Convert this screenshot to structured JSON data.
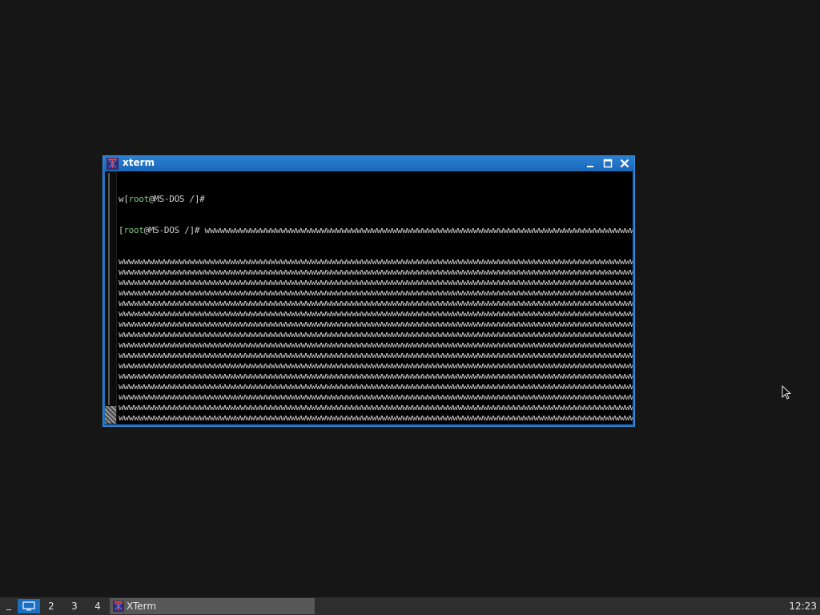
{
  "window": {
    "title": "xterm",
    "terminal": {
      "line1": {
        "prefix": "w[",
        "user": "root",
        "host": "@MS-DOS /]#",
        "rest": ""
      },
      "line2": {
        "prefix": "[",
        "user": "root",
        "host": "@MS-DOS /]#",
        "rest": " wwwwwwwwwwwwwwwwwwwwwwwwwwwwwwwwwwwwwwwwwwwwwwwwwwwwwwwwwwwwwwwwwwwwwwwwwwwwwwwwwwwwwwwwwwwwwwwwwww"
      },
      "fill_line": "wwwwwwwwwwwwwwwwwwwwwwwwwwwwwwwwwwwwwwwwwwwwwwwwwwwwwwwwwwwwwwwwwwwwwwwwwwwwwwwwwwwwwwwwwwwwwwwwwwwwwwwwwwwwwwww",
      "last_line": "wwwwwwwwwwwwwwwwwwwwwwwwwwwwwwwwwwwwwwwwwwww"
    }
  },
  "taskbar": {
    "menu_glyph": "_",
    "workspaces": [
      "",
      "2",
      "3",
      "4"
    ],
    "task_label": "XTerm",
    "clock": "12:23"
  },
  "colors": {
    "accent": "#1b6fc0",
    "desktop": "#161616",
    "prompt_user": "#7ec77e",
    "taskbar": "#2e2e2e"
  }
}
